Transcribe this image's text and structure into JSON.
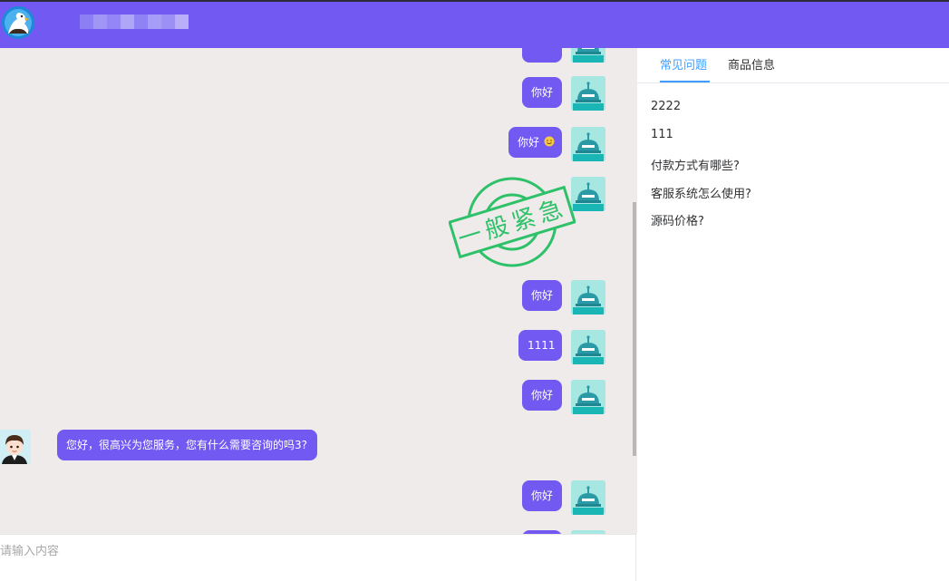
{
  "side": {
    "tabs": [
      {
        "label": "常见问题",
        "active": true
      },
      {
        "label": "商品信息",
        "active": false
      }
    ],
    "faq": [
      "2222",
      "111",
      "付款方式有哪些?",
      "客服系统怎么使用?",
      "源码价格?"
    ]
  },
  "chat": {
    "messages": [
      {
        "from": "visitor",
        "text": "你好"
      },
      {
        "from": "visitor",
        "text": "你好",
        "emoji": "smile"
      },
      {
        "from": "visitor",
        "text": "",
        "stamp": true
      },
      {
        "from": "visitor",
        "text": "你好"
      },
      {
        "from": "visitor",
        "text": "1111"
      },
      {
        "from": "visitor",
        "text": "你好"
      },
      {
        "from": "agent",
        "text": "您好，很高兴为您服务，您有什么需要咨询的吗3?"
      },
      {
        "from": "visitor",
        "text": "你好"
      }
    ],
    "stamp_text": "一般紧急"
  },
  "input": {
    "placeholder": "请输入内容"
  },
  "colors": {
    "brand": "#7159f2",
    "chat_bg": "#efebea",
    "tab_active": "#409eff",
    "stamp": "#2fc16a",
    "bot_avatar": "#a6e7e1"
  }
}
